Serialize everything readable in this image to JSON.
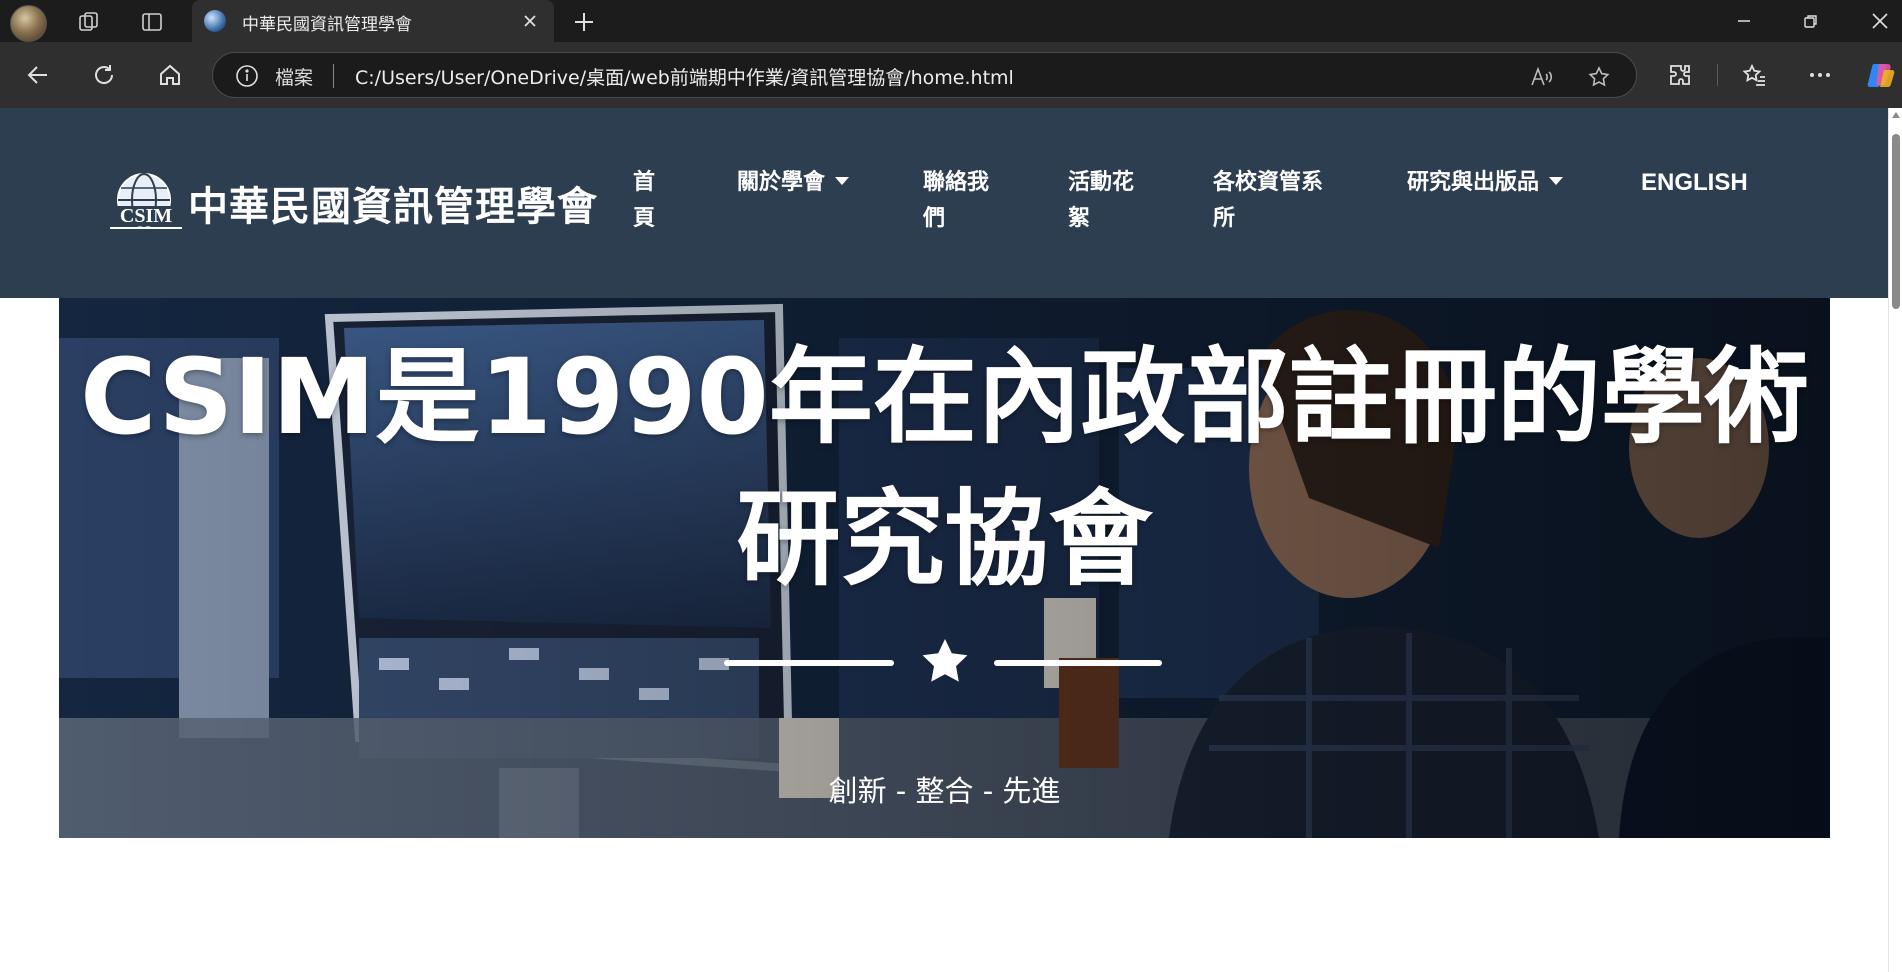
{
  "browser": {
    "tab_title": "中華民國資訊管理學會",
    "address_label": "檔案",
    "url": "C:/Users/User/OneDrive/桌面/web前端期中作業/資訊管理協會/home.html"
  },
  "site": {
    "brand_name": "中華民國資訊管理學會",
    "logo_text": "CSIM",
    "nav": {
      "home": "首頁",
      "about": "關於學會",
      "contact": "聯絡我們",
      "gallery": "活動花絮",
      "schools": "各校資管系所",
      "research": "研究與出版品",
      "english": "ENGLISH"
    }
  },
  "hero": {
    "title": "CSIM是1990年在內政部註冊的學術研究協會",
    "subtitle": "創新 - 整合 - 先進"
  },
  "colors": {
    "nav_bg": "#2c3e50",
    "chrome_dark": "#1c1c1c",
    "chrome_toolbar": "#2f2f2f",
    "text_light": "#ffffff"
  }
}
